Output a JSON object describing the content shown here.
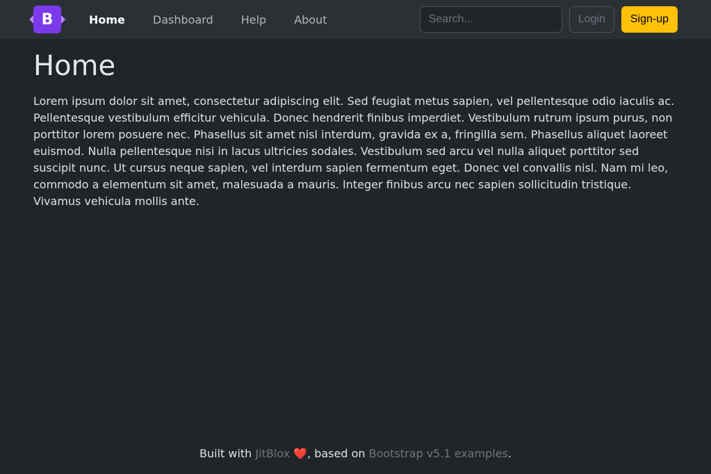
{
  "brand": {
    "letter": "B"
  },
  "nav": {
    "items": [
      {
        "label": "Home",
        "active": true
      },
      {
        "label": "Dashboard",
        "active": false
      },
      {
        "label": "Help",
        "active": false
      },
      {
        "label": "About",
        "active": false
      }
    ]
  },
  "search": {
    "placeholder": "Search..."
  },
  "buttons": {
    "login": "Login",
    "signup": "Sign-up"
  },
  "page": {
    "title": "Home",
    "body": "Lorem ipsum dolor sit amet, consectetur adipiscing elit. Sed feugiat metus sapien, vel pellentesque odio iaculis ac. Pellentesque vestibulum efficitur vehicula. Donec hendrerit finibus imperdiet. Vestibulum rutrum ipsum purus, non porttitor lorem posuere nec. Phasellus sit amet nisl interdum, gravida ex a, fringilla sem. Phasellus aliquet laoreet euismod. Nulla pellentesque nisi in lacus ultricies sodales. Vestibulum sed arcu vel nulla aliquet porttitor sed suscipit nunc. Ut cursus neque sapien, vel interdum sapien fermentum eget. Donec vel convallis nisl. Nam mi leo, commodo a elementum sit amet, malesuada a mauris. Integer finibus arcu nec sapien sollicitudin tristique. Vivamus vehicula mollis ante."
  },
  "footer": {
    "prefix": "Built with ",
    "link1": "JitBlox",
    "heart": " ❤️",
    "mid": ", based on ",
    "link2": "Bootstrap v5.1 examples",
    "suffix": "."
  }
}
